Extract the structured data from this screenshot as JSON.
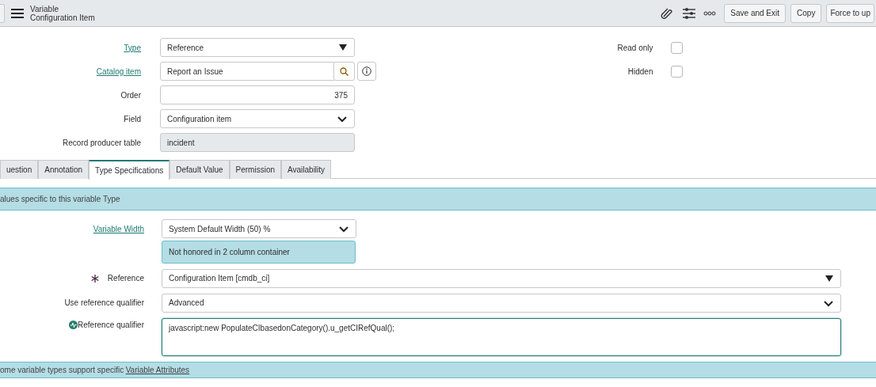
{
  "header": {
    "title": "Variable",
    "subtitle": "Configuration Item",
    "buttons": [
      "Save and Exit",
      "Copy",
      "Force to up"
    ]
  },
  "fields": [
    {
      "label": "Type",
      "link": true,
      "kind": "dropdown",
      "value": "Reference"
    },
    {
      "label": "Catalog item",
      "link": true,
      "kind": "reference",
      "value": "Report an Issue"
    },
    {
      "label": "Order",
      "link": false,
      "kind": "number",
      "value": "375"
    },
    {
      "label": "Field",
      "link": false,
      "kind": "select",
      "value": "Configuration item"
    },
    {
      "label": "Record producer table",
      "link": false,
      "kind": "readonly",
      "value": "incident"
    }
  ],
  "flags": [
    {
      "label": "Read only",
      "checked": false
    },
    {
      "label": "Hidden",
      "checked": false
    }
  ],
  "tabs": [
    {
      "label": "uestion",
      "selected": false
    },
    {
      "label": "Annotation",
      "selected": false
    },
    {
      "label": "Type Specifications",
      "selected": true
    },
    {
      "label": "Default Value",
      "selected": false
    },
    {
      "label": "Permission",
      "selected": false
    },
    {
      "label": "Availability",
      "selected": false
    }
  ],
  "section": {
    "title": "alues specific to this variable Type"
  },
  "type_fields": [
    {
      "label": "Variable Width",
      "link": true,
      "kind": "select",
      "value": "System Default Width (50) %",
      "note": "Not honored in 2 column container"
    },
    {
      "label": "Reference",
      "link": false,
      "mandatory": true,
      "kind": "dropdown",
      "value": "Configuration Item [cmdb_ci]"
    },
    {
      "label": "Use reference qualifier",
      "link": false,
      "kind": "select",
      "value": "Advanced"
    },
    {
      "label": "Reference qualifier",
      "link": false,
      "scripted": true,
      "kind": "textarea",
      "focused": true,
      "value": "javascript:new PopulateCIbasedonCategory().u_getCIRefQual();"
    }
  ],
  "footer": {
    "text": "ome variable types support specific",
    "link": "Variable Attributes"
  }
}
